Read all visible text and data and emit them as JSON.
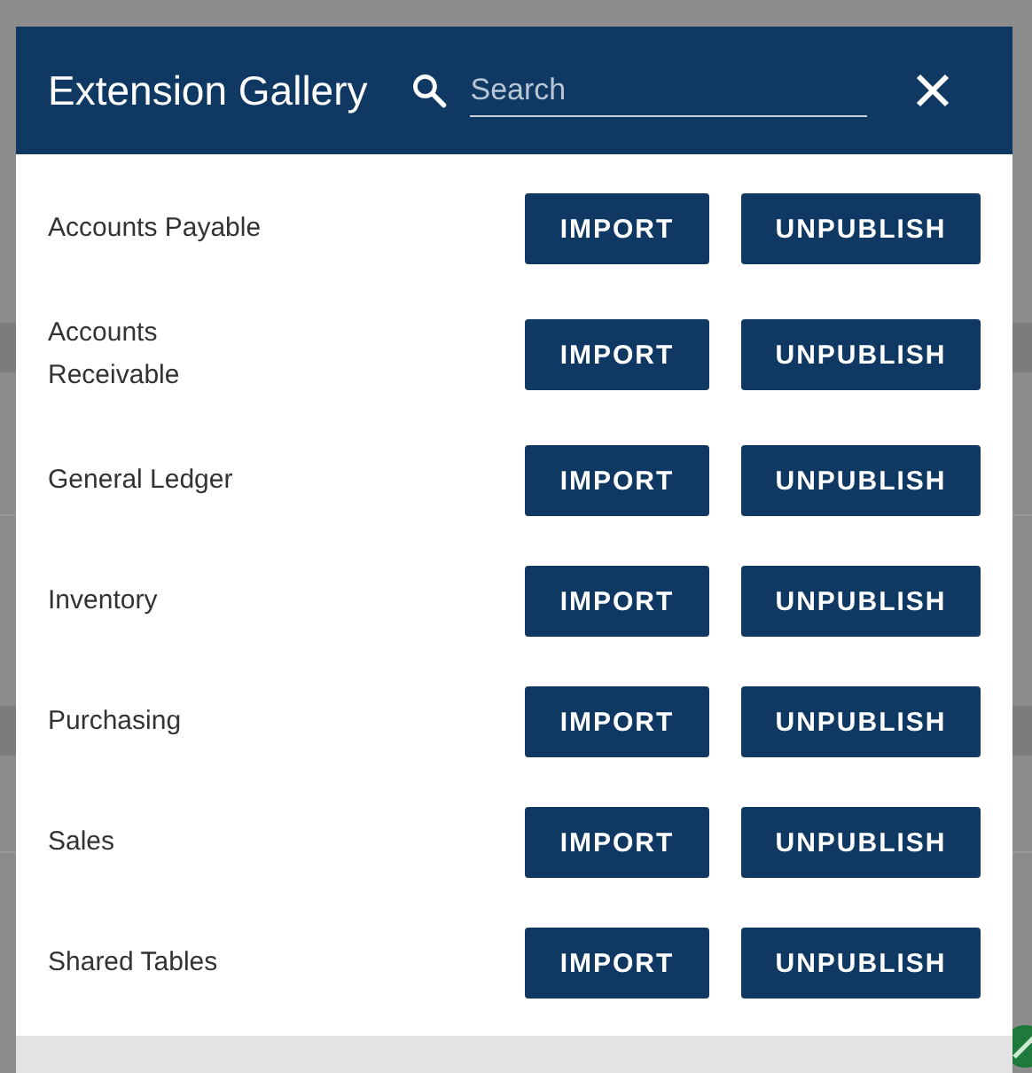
{
  "dialog": {
    "title": "Extension Gallery",
    "search": {
      "placeholder": "Search"
    },
    "extensions": [
      {
        "name": "Accounts Payable",
        "buttons": [
          "IMPORT",
          "UNPUBLISH"
        ]
      },
      {
        "name": "Accounts Receivable",
        "buttons": [
          "IMPORT",
          "UNPUBLISH"
        ]
      },
      {
        "name": "General Ledger",
        "buttons": [
          "IMPORT",
          "UNPUBLISH"
        ]
      },
      {
        "name": "Inventory",
        "buttons": [
          "IMPORT",
          "UNPUBLISH"
        ]
      },
      {
        "name": "Purchasing",
        "buttons": [
          "IMPORT",
          "UNPUBLISH"
        ]
      },
      {
        "name": "Sales",
        "buttons": [
          "IMPORT",
          "UNPUBLISH"
        ]
      },
      {
        "name": "Shared Tables",
        "buttons": [
          "IMPORT",
          "UNPUBLISH"
        ]
      }
    ]
  }
}
